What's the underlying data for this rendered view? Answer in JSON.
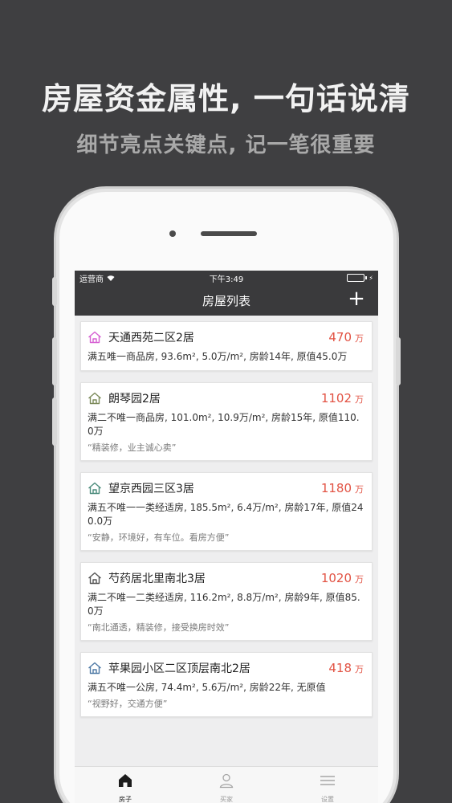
{
  "promo": {
    "headline": "房屋资金属性, 一句话说清",
    "subline": "细节亮点关键点, 记一笔很重要"
  },
  "statusbar": {
    "carrier": "运营商",
    "time": "下午3:49",
    "battery_color": "#4cd964"
  },
  "navbar": {
    "title": "房屋列表",
    "add_label": "+"
  },
  "houses": [
    {
      "title": "天通西苑二区2居",
      "price": "470",
      "unit": "万",
      "desc": "满五唯一商品房, 93.6m², 5.0万/m², 房龄14年, 原值45.0万",
      "quote": "",
      "icon_color": "#d65fd2"
    },
    {
      "title": "朗琴园2居",
      "price": "1102",
      "unit": "万",
      "desc": "满二不唯一商品房, 101.0m², 10.9万/m², 房龄15年, 原值110.0万",
      "quote": "“精装修，业主诚心卖”",
      "icon_color": "#7c8a5a"
    },
    {
      "title": "望京西园三区3居",
      "price": "1180",
      "unit": "万",
      "desc": "满五不唯一一类经适房, 185.5m², 6.4万/m², 房龄17年, 原值240.0万",
      "quote": "“安静，环境好，有车位。看房方便”",
      "icon_color": "#4c8c7c"
    },
    {
      "title": "芍药居北里南北3居",
      "price": "1020",
      "unit": "万",
      "desc": "满二不唯一二类经适房, 116.2m², 8.8万/m², 房龄9年, 原值85.0万",
      "quote": "“南北通透，精装修，接受换房时效”",
      "icon_color": "#555555"
    },
    {
      "title": "苹果园小区二区顶层南北2居",
      "price": "418",
      "unit": "万",
      "desc": "满五不唯一公房, 74.4m², 5.6万/m², 房龄22年, 无原值",
      "quote": "“视野好，交通方便”",
      "icon_color": "#4f7aa6"
    }
  ],
  "tabbar": {
    "tabs": [
      {
        "label": "房子",
        "icon": "home-icon",
        "active": true
      },
      {
        "label": "买家",
        "icon": "person-icon",
        "active": false
      },
      {
        "label": "设置",
        "icon": "menu-icon",
        "active": false
      }
    ]
  },
  "colors": {
    "background": "#3f3f41",
    "navbar": "#3a3a3c",
    "price": "#e25243"
  }
}
